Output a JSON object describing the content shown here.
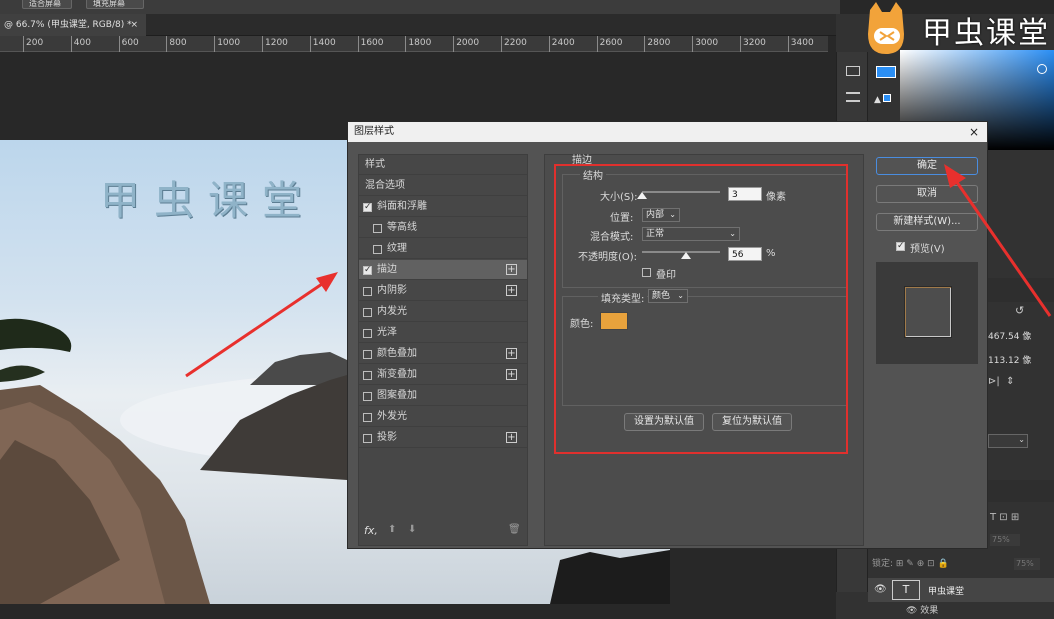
{
  "topbar": {
    "button1": "适合屏幕",
    "button2": "填充屏幕"
  },
  "document_tab": {
    "title": "@ 66.7% (甲虫课堂, RGB/8) *",
    "close": "×"
  },
  "ruler": {
    "ticks": [
      "200",
      "400",
      "600",
      "800",
      "1000",
      "1200",
      "1400",
      "1600",
      "1800",
      "2000",
      "2200",
      "2400",
      "2600",
      "2800",
      "3000",
      "3200",
      "3400"
    ]
  },
  "canvas": {
    "wordmark": "甲虫课堂"
  },
  "watermark": {
    "text": "甲虫课堂"
  },
  "right_panel": {
    "values": [
      "467.54 像",
      "113.12 像"
    ],
    "opacity_label": "75%",
    "fill_label": "75%",
    "lock_label": "锁定:",
    "layer_name": "甲虫课堂",
    "layer_effect": "效果"
  },
  "dialog": {
    "title": "图层样式",
    "close": "×",
    "styles_list": [
      {
        "label": "样式",
        "checkbox": false,
        "checked": false,
        "plus": false,
        "indent": false
      },
      {
        "label": "混合选项",
        "checkbox": false,
        "checked": false,
        "plus": false,
        "indent": false
      },
      {
        "label": "斜面和浮雕",
        "checkbox": true,
        "checked": true,
        "plus": false,
        "indent": false
      },
      {
        "label": "等高线",
        "checkbox": true,
        "checked": false,
        "plus": false,
        "indent": true
      },
      {
        "label": "纹理",
        "checkbox": true,
        "checked": false,
        "plus": false,
        "indent": true
      },
      {
        "label": "描边",
        "checkbox": true,
        "checked": true,
        "plus": true,
        "indent": false,
        "selected": true
      },
      {
        "label": "内阴影",
        "checkbox": true,
        "checked": false,
        "plus": true,
        "indent": false
      },
      {
        "label": "内发光",
        "checkbox": true,
        "checked": false,
        "plus": false,
        "indent": false
      },
      {
        "label": "光泽",
        "checkbox": true,
        "checked": false,
        "plus": false,
        "indent": false
      },
      {
        "label": "颜色叠加",
        "checkbox": true,
        "checked": false,
        "plus": true,
        "indent": false
      },
      {
        "label": "渐变叠加",
        "checkbox": true,
        "checked": false,
        "plus": true,
        "indent": false
      },
      {
        "label": "图案叠加",
        "checkbox": true,
        "checked": false,
        "plus": false,
        "indent": false
      },
      {
        "label": "外发光",
        "checkbox": true,
        "checked": false,
        "plus": false,
        "indent": false
      },
      {
        "label": "投影",
        "checkbox": true,
        "checked": false,
        "plus": true,
        "indent": false
      }
    ],
    "fx_label": "fx,",
    "stroke": {
      "section_title": "描边",
      "structure_title": "结构",
      "size_label": "大小(S):",
      "size_value": "3",
      "size_unit": "像素",
      "size_slider": 0.0,
      "position_label": "位置:",
      "position_value": "内部",
      "blend_label": "混合模式:",
      "blend_value": "正常",
      "opacity_label": "不透明度(O):",
      "opacity_value": "56",
      "opacity_unit": "%",
      "opacity_slider": 0.56,
      "overprint_label": "叠印",
      "fill_type_label": "填充类型:",
      "fill_type_value": "颜色",
      "color_label": "颜色:",
      "color_value": "#e8a23c",
      "set_default": "设置为默认值",
      "reset_default": "复位为默认值"
    },
    "buttons": {
      "ok": "确定",
      "cancel": "取消",
      "new_style": "新建样式(W)...",
      "preview": "预览(V)"
    },
    "preview_checked": true
  },
  "colors": {
    "highlight": "#e0302d",
    "accent": "#4a8de0"
  }
}
